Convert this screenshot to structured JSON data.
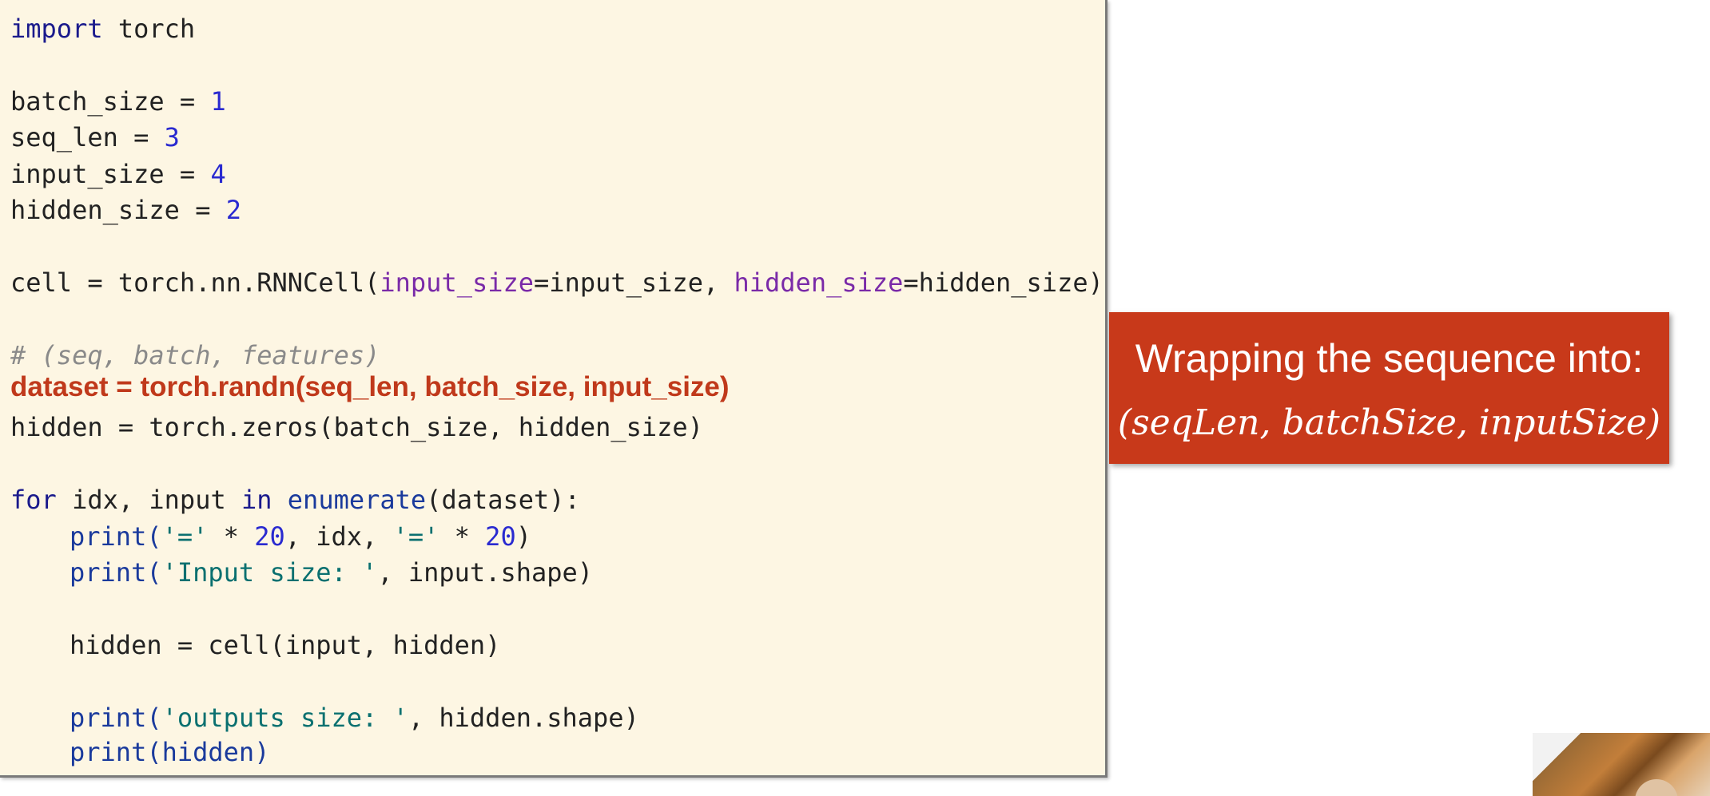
{
  "code": {
    "import_kw": "import",
    "import_mod": " torch",
    "batch_name": "batch_size = ",
    "batch_val": "1",
    "seq_name": "seq_len = ",
    "seq_val": "3",
    "input_name": "input_size = ",
    "input_val": "4",
    "hidden_name": "hidden_size = ",
    "hidden_val": "2",
    "cell_pre": "cell = torch.nn.RNNCell(",
    "cell_arg1": "input_size",
    "cell_mid": "=input_size, ",
    "cell_arg2": "hidden_size",
    "cell_end": "=hidden_size)",
    "comment": "# (seq, batch, features)",
    "dataset_line": "dataset = torch.randn(seq_len, batch_size, input_size)",
    "hidden_line": "hidden = torch.zeros(batch_size, hidden_size)",
    "for_kw": "for",
    "for_mid": " idx, input ",
    "in_kw": "in",
    "for_space": " ",
    "enumerate_fn": "enumerate",
    "for_end": "(dataset):",
    "p1_pre": "print(",
    "p1_str1": "'='",
    "p1_mid1": " * ",
    "p1_n1": "20",
    "p1_mid2": ", idx, ",
    "p1_str2": "'='",
    "p1_mid3": " * ",
    "p1_n2": "20",
    "p1_end": ")",
    "p2_pre": "print(",
    "p2_str": "'Input size: '",
    "p2_end": ", input.shape)",
    "cell_call": "hidden = cell(input, hidden)",
    "p3_pre": "print(",
    "p3_str": "'outputs size: '",
    "p3_end": ", hidden.shape)",
    "p4": "print(hidden)"
  },
  "callout": {
    "title": "Wrapping the sequence into:",
    "formula": "(seqLen, batchSize, inputSize)",
    "color": "#c8391a"
  },
  "colors": {
    "code_background": "#fdf6e3",
    "highlight": "#c0391b"
  }
}
